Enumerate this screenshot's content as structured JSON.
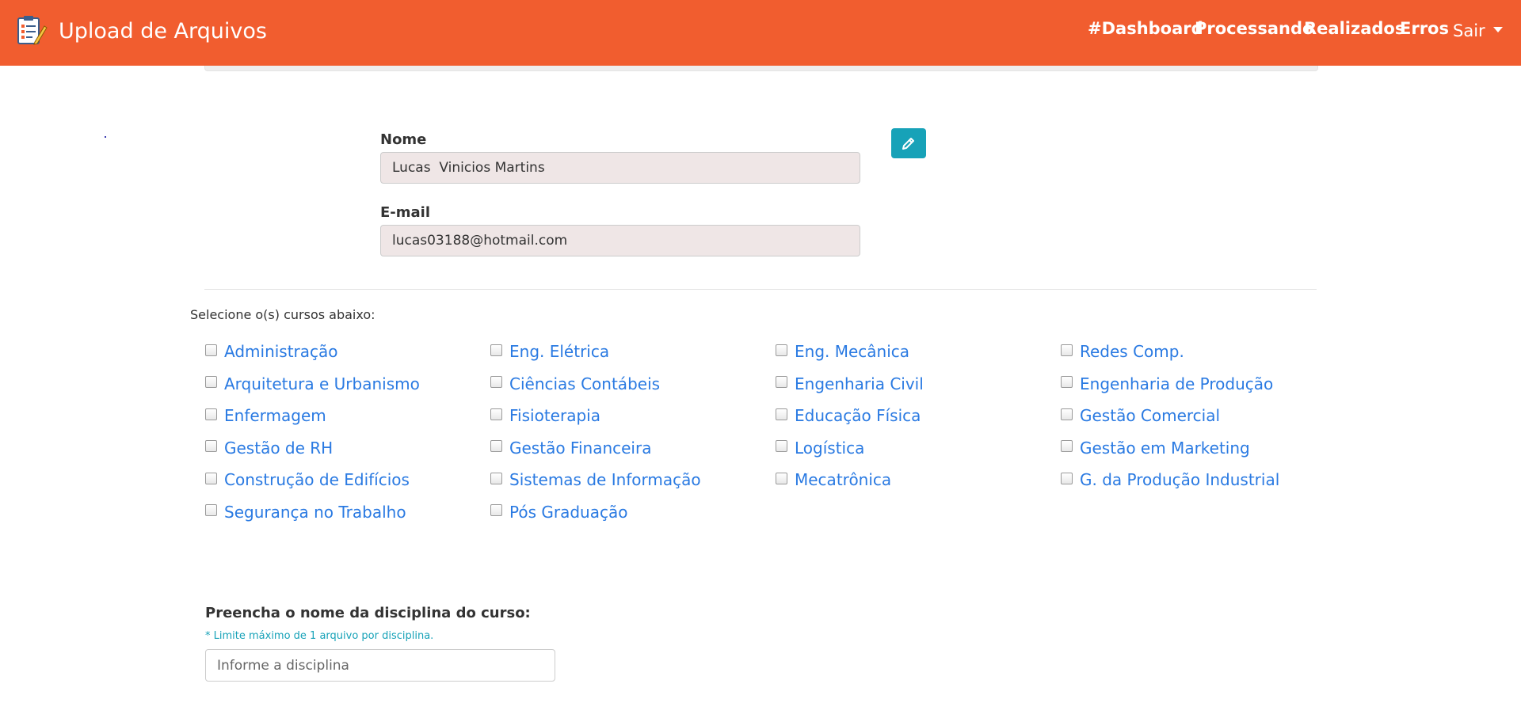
{
  "header": {
    "title": "Upload de Arquivos",
    "nav": [
      "#Dashboard",
      "Processando",
      "Realizados",
      "Erros"
    ],
    "user_menu": "Sair"
  },
  "profile": {
    "name_label": "Nome",
    "name_value": "Lucas  Vinicios Martins",
    "email_label": "E-mail",
    "email_value": "lucas03188@hotmail.com",
    "edit_icon": "pencil-icon"
  },
  "courses": {
    "title": "Selecione o(s) cursos abaixo:",
    "items": [
      "Administração",
      "Eng. Elétrica",
      "Eng. Mecânica",
      "Redes Comp.",
      "Arquitetura e Urbanismo",
      "Ciências Contábeis",
      "Engenharia Civil",
      "Engenharia de Produção",
      "Enfermagem",
      "Fisioterapia",
      "Educação Física",
      "Gestão Comercial",
      "Gestão de RH",
      "Gestão Financeira",
      "Logística",
      "Gestão em Marketing",
      "Construção de Edifícios",
      "Sistemas de Informação",
      "Mecatrônica",
      "G. da Produção Industrial",
      "Segurança no Trabalho",
      "Pós Graduação"
    ]
  },
  "discipline": {
    "label": "Preencha o nome da disciplina do curso:",
    "hint": "* Limite máximo de 1 arquivo por disciplina.",
    "placeholder": "Informe a disciplina",
    "value": ""
  },
  "colors": {
    "navbar": "#f15d2f",
    "link": "#2a7ae2",
    "info": "#17a2b8",
    "input_readonly_bg": "#efe6e6"
  }
}
